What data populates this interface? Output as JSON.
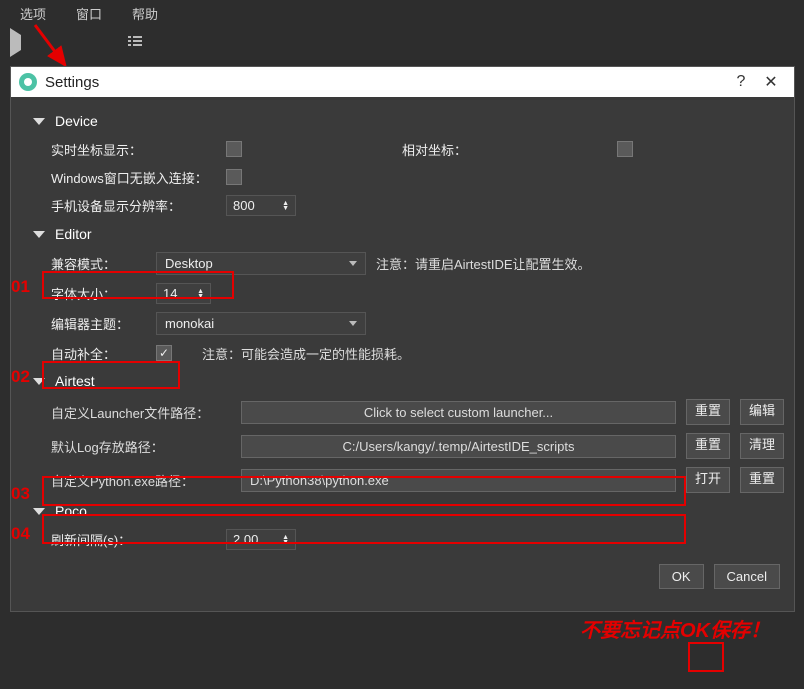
{
  "menu": {
    "options": "选项",
    "window": "窗口",
    "help": "帮助"
  },
  "title": "Settings",
  "help_mark": "?",
  "close_mark": "✕",
  "sections": {
    "device": "Device",
    "editor": "Editor",
    "airtest": "Airtest",
    "poco": "Poco"
  },
  "device": {
    "realtime_coord": "实时坐标显示：",
    "relative_coord": "相对坐标：",
    "windows_no_embed": "Windows窗口无嵌入连接：",
    "phone_resolution": "手机设备显示分辨率：",
    "phone_resolution_value": "800"
  },
  "editor": {
    "compat_mode": "兼容模式：",
    "compat_value": "Desktop",
    "compat_note": "注意：请重启AirtestIDE让配置生效。",
    "font_size": "字体大小：",
    "font_size_value": "14",
    "theme": "编辑器主题：",
    "theme_value": "monokai",
    "autocomplete": "自动补全：",
    "autocomplete_note": "注意：可能会造成一定的性能损耗。"
  },
  "airtest": {
    "launcher_label": "自定义Launcher文件路径：",
    "launcher_placeholder": "Click to select custom launcher...",
    "reset": "重置",
    "edit": "编辑",
    "log_label": "默认Log存放路径：",
    "log_value": "C:/Users/kangy/.temp/AirtestIDE_scripts",
    "clean": "清理",
    "python_label": "自定义Python.exe路径：",
    "python_value": "D:\\Python38\\python.exe",
    "open": "打开"
  },
  "poco": {
    "refresh_interval": "刷新间隔(s)：",
    "refresh_value": "2.00"
  },
  "buttons": {
    "ok": "OK",
    "cancel": "Cancel"
  },
  "annotations": {
    "n1": "01",
    "n2": "02",
    "n3": "03",
    "n4": "04",
    "note": "不要忘记点OK保存！"
  }
}
